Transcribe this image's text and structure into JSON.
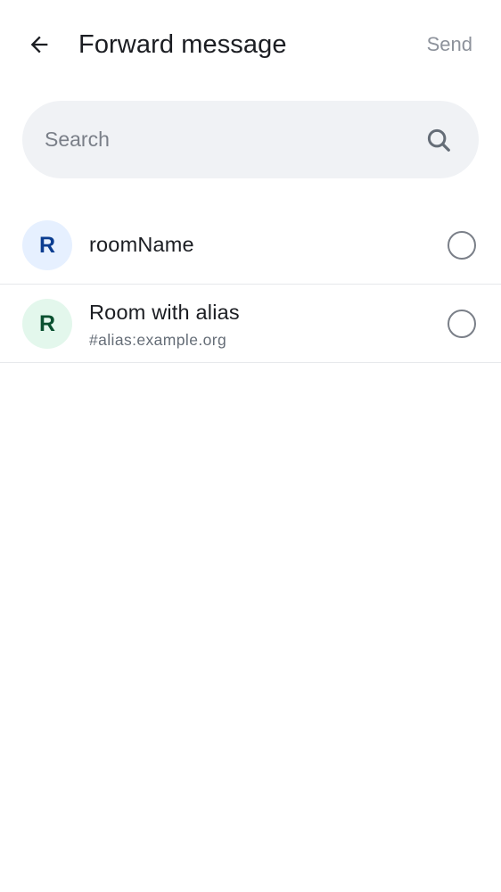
{
  "header": {
    "back_icon": "arrow-left-icon",
    "title": "Forward message",
    "send_label": "Send"
  },
  "search": {
    "placeholder": "Search",
    "value": "",
    "icon": "search-icon"
  },
  "rooms": [
    {
      "avatar_letter": "R",
      "avatar_bg": "#e6f0ff",
      "avatar_fg": "#0b3d91",
      "name": "roomName",
      "alias": "",
      "selected": false
    },
    {
      "avatar_letter": "R",
      "avatar_bg": "#e3f7ec",
      "avatar_fg": "#0a5130",
      "name": "Room with alias",
      "alias": "#alias:example.org",
      "selected": false
    }
  ],
  "colors": {
    "send_disabled": "#8d929b",
    "search_bg": "#f0f2f5",
    "divider": "#e6e8eb"
  }
}
